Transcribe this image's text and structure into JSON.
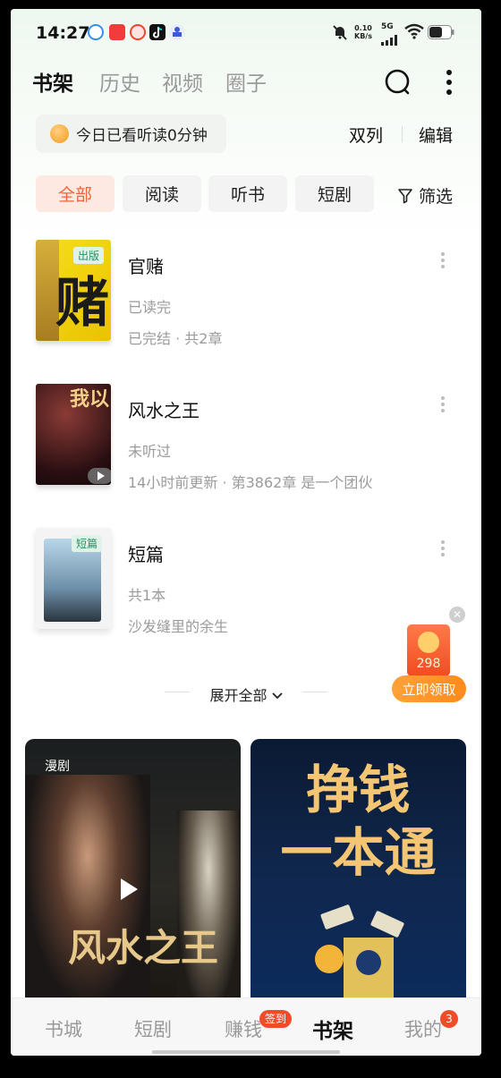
{
  "status_bar": {
    "time": "14:27",
    "net_speed_value": "0.10",
    "net_speed_unit": "KB/s",
    "network": "5G",
    "icons": [
      "app-icon-1",
      "app-icon-2",
      "weibo-icon",
      "tiktok-icon",
      "app-icon-5",
      "mute-icon",
      "signal-icon",
      "wifi-icon",
      "battery-icon"
    ]
  },
  "header": {
    "tabs": [
      {
        "label": "书架"
      },
      {
        "label": "历史"
      },
      {
        "label": "视频"
      },
      {
        "label": "圈子"
      }
    ],
    "icons": [
      "search-icon",
      "more-icon"
    ]
  },
  "read_status": "今日已看听读0分钟",
  "actions": {
    "double_col": "双列",
    "edit": "编辑"
  },
  "filters": {
    "chips": [
      {
        "label": "全部"
      },
      {
        "label": "阅读"
      },
      {
        "label": "听书"
      },
      {
        "label": "短剧"
      }
    ],
    "filter_label": "筛选"
  },
  "books": [
    {
      "title": "官赌",
      "tag": "出版",
      "progress": "已读完",
      "meta": "已完结 · 共2章",
      "cover_text": "赌"
    },
    {
      "title": "风水之王",
      "progress": "未听过",
      "meta": "14小时前更新 · 第3862章 是一个团伙",
      "cover_text": "我以"
    },
    {
      "title": "短篇",
      "tag": "短篇",
      "progress": "共1本",
      "meta": "沙发缝里的余生"
    }
  ],
  "expand_label": "展开全部",
  "red_packet": {
    "amount": "298",
    "button": "立即领取"
  },
  "cards": [
    {
      "tag": "漫剧",
      "title_text": "风水之王"
    },
    {
      "line1": "挣钱",
      "line2": "一本通"
    }
  ],
  "bottom_nav": {
    "items": [
      {
        "label": "书城"
      },
      {
        "label": "短剧"
      },
      {
        "label": "赚钱",
        "badge": "签到"
      },
      {
        "label": "书架"
      },
      {
        "label": "我的",
        "badge": "3"
      }
    ]
  },
  "colors": {
    "accent": "#f0653a",
    "chip_active_bg": "#fde9e2",
    "badge_red": "#f24b2a"
  }
}
